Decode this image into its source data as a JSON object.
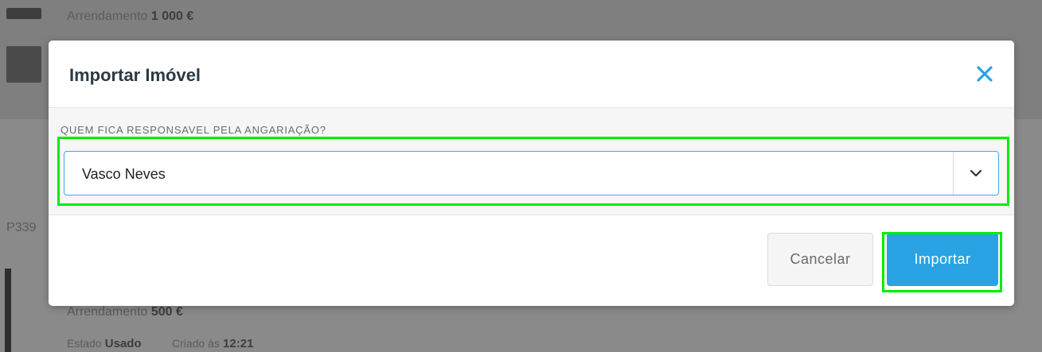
{
  "background": {
    "listing_1_label": "Arrendamento",
    "listing_1_price": "1 000 €",
    "listing_2_ref": "P339",
    "listing_3_label": "Arrendamento",
    "listing_3_price": "500 €",
    "listing_3_state_label": "Estado",
    "listing_3_state_value": "Usado",
    "listing_3_created_label": "Criado às",
    "listing_3_created_value": "12:21"
  },
  "modal": {
    "title": "Importar Imóvel",
    "close_icon": "close-icon",
    "field_label": "QUEM FICA RESPONSAVEL PELA ANGARIAÇÃO?",
    "select_value": "Vasco Neves",
    "select_icon": "chevron-down-icon",
    "cancel_label": "Cancelar",
    "import_label": "Importar"
  },
  "colors": {
    "accent": "#29a3e4",
    "highlight": "#00ee00",
    "select_border": "#3fa9f5",
    "title": "#2c3a44"
  }
}
